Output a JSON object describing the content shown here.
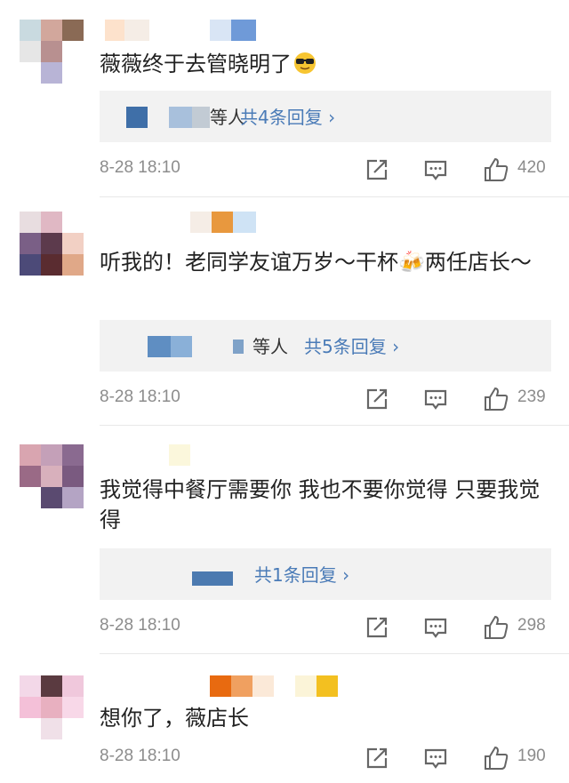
{
  "colors": {
    "link": "#4a7bb7",
    "meta": "#8c8c8c",
    "reply_bg": "#f2f2f2"
  },
  "comments": [
    {
      "text": "薇薇终于去管晓明了",
      "emoji": "sunglasses-emoji",
      "reply_suffix": "等人",
      "reply_link": "共4条回复 ›",
      "time": "8-28 18:10",
      "likes": "420"
    },
    {
      "text": "听我的！老同学友谊万岁～干杯🍻两任店长～",
      "reply_suffix": "等人",
      "reply_link": "共5条回复 ›",
      "time": "8-28 18:10",
      "likes": "239"
    },
    {
      "text": "我觉得中餐厅需要你 我也不要你觉得 只要我觉得",
      "reply_link": "共1条回复 ›",
      "time": "8-28 18:10",
      "likes": "298"
    },
    {
      "text": "想你了，薇店长",
      "time": "8-28 18:10",
      "likes": "190"
    }
  ]
}
